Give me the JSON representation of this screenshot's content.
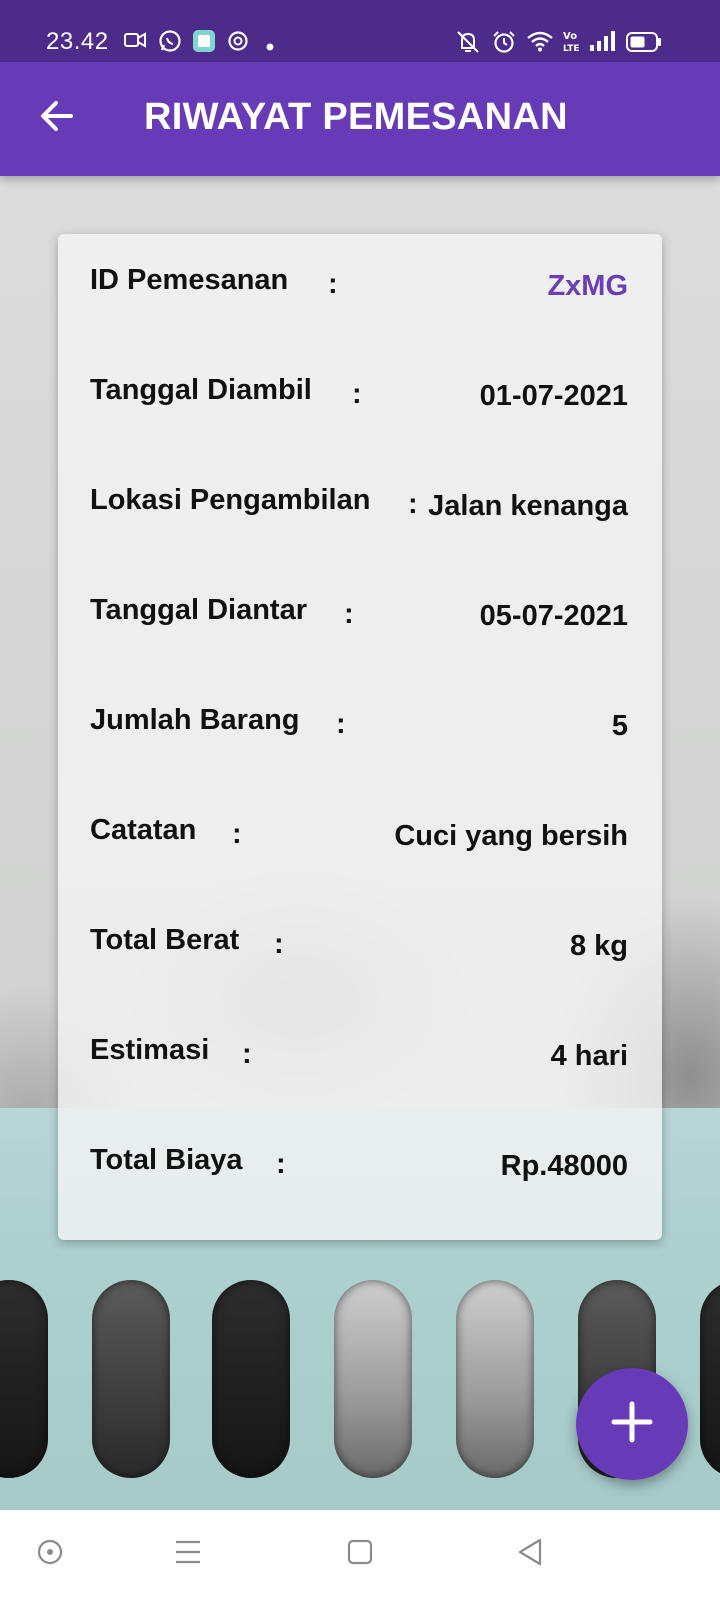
{
  "status_bar": {
    "time": "23.42",
    "left_icons": [
      "video-camera-icon",
      "whatsapp-icon",
      "app-icon",
      "vpn-icon",
      "dot-icon"
    ],
    "right_icons": [
      "mute-icon",
      "alarm-icon",
      "wifi-icon",
      "volte-icon",
      "signal-icon",
      "battery-icon"
    ]
  },
  "app_bar": {
    "title": "RIWAYAT PEMESANAN",
    "back_icon": "arrow-left-icon",
    "background_color": "#673ab7",
    "status_color": "#4d2b8b"
  },
  "order_detail": {
    "rows": [
      {
        "label": "ID Pemesanan",
        "colon": ":",
        "value": "ZxMG"
      },
      {
        "label": "Tanggal Diambil",
        "colon": ":",
        "value": "01-07-2021"
      },
      {
        "label": "Lokasi Pengambilan",
        "colon": ":",
        "value": "Jalan kenanga"
      },
      {
        "label": "Tanggal Diantar",
        "colon": ":",
        "value": "05-07-2021"
      },
      {
        "label": "Jumlah Barang",
        "colon": ":",
        "value": "5"
      },
      {
        "label": "Catatan",
        "colon": ":",
        "value": "Cuci yang bersih"
      },
      {
        "label": "Total Berat",
        "colon": ":",
        "value": "8 kg"
      },
      {
        "label": "Estimasi",
        "colon": ":",
        "value": "4 hari"
      },
      {
        "label": "Total Biaya",
        "colon": ":",
        "value": "Rp.48000"
      }
    ],
    "accent_color": "#6a3fb5"
  },
  "fab": {
    "icon": "plus-icon"
  },
  "nav_bar": {
    "icons": [
      "assistant-icon",
      "menu-icon",
      "home-icon",
      "back-icon"
    ]
  }
}
